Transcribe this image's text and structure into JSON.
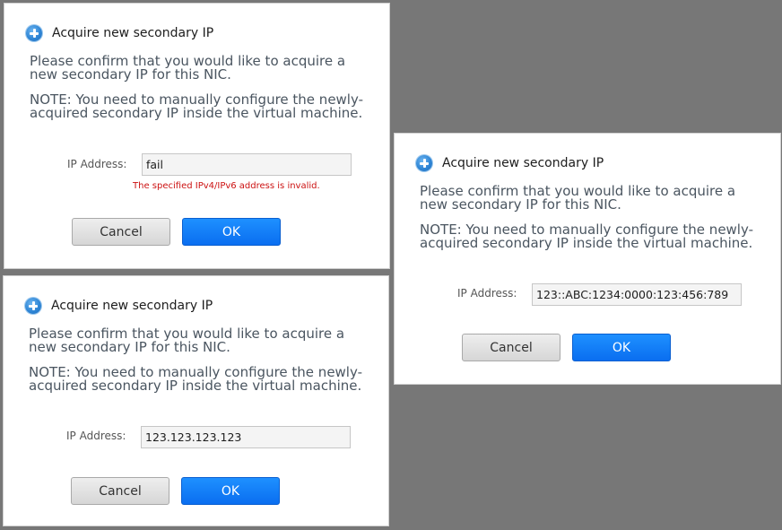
{
  "dialogs": [
    {
      "title": "Acquire new secondary IP",
      "message": "Please confirm that you would like to acquire a new secondary IP for this NIC.",
      "note": "NOTE: You need to manually configure the newly-acquired secondary IP inside the virtual machine.",
      "ip_label": "IP Address:",
      "ip_value": "fail",
      "error": "The specified IPv4/IPv6 address is invalid.",
      "cancel_label": "Cancel",
      "ok_label": "OK"
    },
    {
      "title": "Acquire new secondary IP",
      "message": "Please confirm that you would like to acquire a new secondary IP for this NIC.",
      "note": "NOTE: You need to manually configure the newly-acquired secondary IP inside the virtual machine.",
      "ip_label": "IP Address:",
      "ip_value": "123.123.123.123",
      "cancel_label": "Cancel",
      "ok_label": "OK"
    },
    {
      "title": "Acquire new secondary IP",
      "message": "Please confirm that you would like to acquire a new secondary IP for this NIC.",
      "note": "NOTE: You need to manually configure the newly-acquired secondary IP inside the virtual machine.",
      "ip_label": "IP Address:",
      "ip_value": "123::ABC:1234:0000:123:456:789",
      "cancel_label": "Cancel",
      "ok_label": "OK"
    }
  ],
  "icons": {
    "title_icon": "plus-circle-icon"
  },
  "colors": {
    "backdrop": "#777777",
    "ok_button": "#0a6ef0",
    "error_text": "#cc1111",
    "accent_icon": "#2f86d6"
  }
}
